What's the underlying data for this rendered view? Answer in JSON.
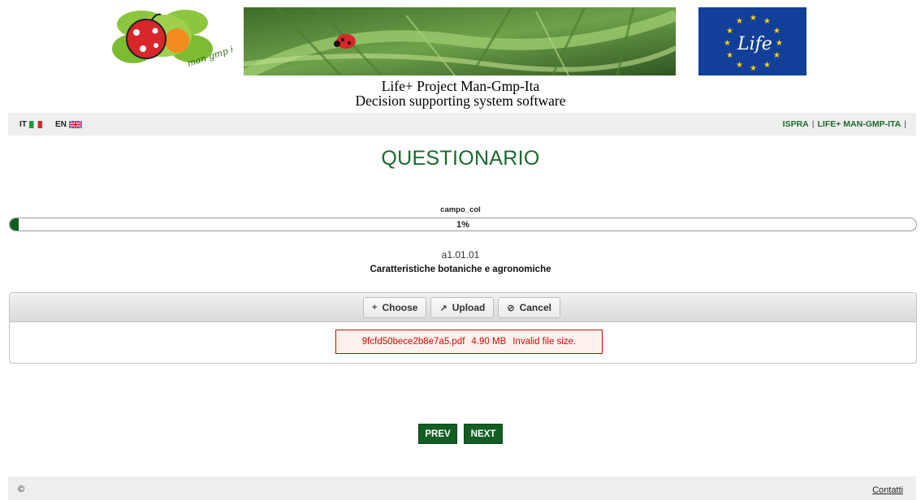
{
  "header": {
    "project_line1": "Life+ Project Man-Gmp-Ita",
    "project_line2": "Decision supporting system software",
    "logo_text": "man gmp ita",
    "eu_logo_text": "Life"
  },
  "topbar": {
    "lang_it": "IT",
    "lang_en": "EN",
    "link_ispra": "ISPRA",
    "link_life": "LIFE+ MAN-GMP-ITA",
    "separator": "|"
  },
  "main": {
    "heading": "QUESTIONARIO",
    "progress_title": "campo_col",
    "progress_value": 1,
    "progress_label": "1%",
    "section_code": "a1.01.01",
    "section_title": "Caratteristiche botaniche e agronomiche"
  },
  "upload": {
    "choose_label": "Choose",
    "upload_label": "Upload",
    "cancel_label": "Cancel",
    "choose_icon": "plus-icon",
    "upload_icon": "upload-arrow-icon",
    "cancel_icon": "cancel-icon",
    "error_filename": "9fcfd50bece2b8e7a5.pdf",
    "error_size": "4.90 MB",
    "error_message": "Invalid file size."
  },
  "nav": {
    "prev_label": "PREV",
    "next_label": "NEXT"
  },
  "footer": {
    "copyright": "©",
    "contact": "Contatti"
  },
  "colors": {
    "brand_green": "#1a6a2e",
    "button_green": "#125e24",
    "error_red": "#cd0a0a"
  }
}
